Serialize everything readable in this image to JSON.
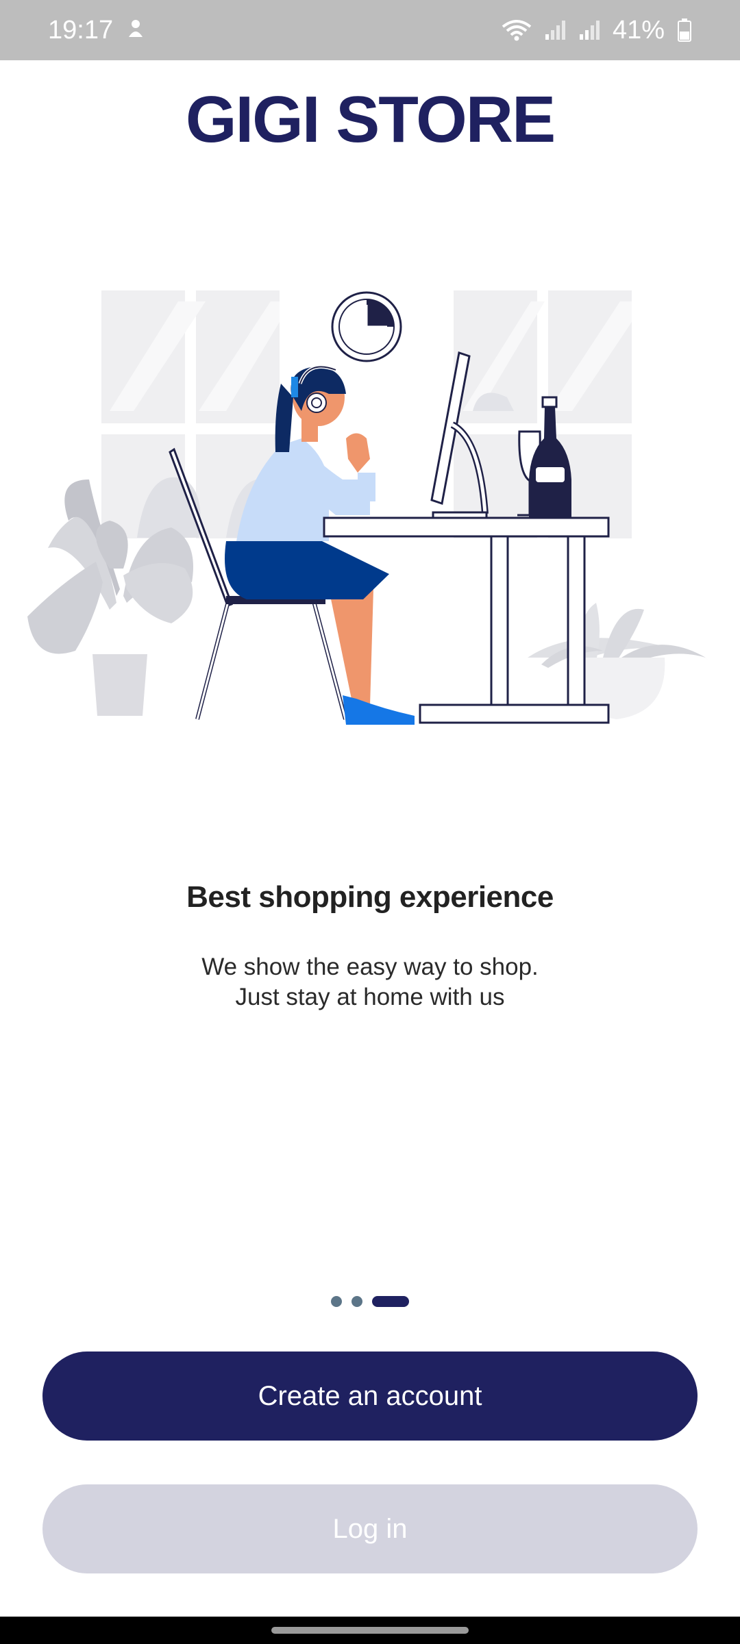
{
  "status_bar": {
    "time": "19:17",
    "battery": "41%",
    "icons": [
      "user-icon",
      "wifi-icon",
      "signal-icon",
      "signal-icon",
      "battery-icon"
    ]
  },
  "app": {
    "brand_title": "GIGI STORE"
  },
  "onboarding": {
    "headline": "Best shopping experience",
    "subtext_line1": "We show the easy way to shop.",
    "subtext_line2": "Just stay at home with us",
    "pager": {
      "total": 3,
      "active_index": 2
    }
  },
  "actions": {
    "create_label": "Create an account",
    "login_label": "Log in"
  },
  "colors": {
    "primary": "#1f2160",
    "disabled": "#d3d3df",
    "status_bar": "#bdbdbd"
  }
}
